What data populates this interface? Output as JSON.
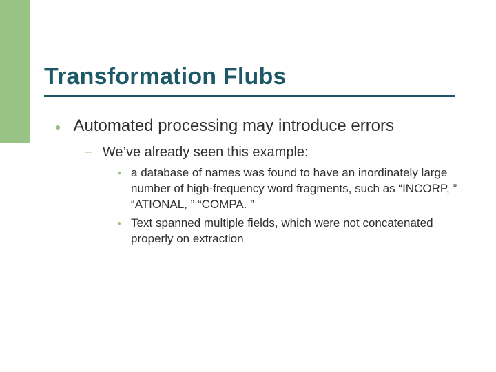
{
  "slide": {
    "title": "Transformation Flubs",
    "level1": {
      "text": "Automated processing may introduce errors"
    },
    "level2": {
      "text": "We’ve already seen this example:"
    },
    "level3": [
      {
        "text": "a database of names was found to have an inordinately large number of high-frequency word fragments, such as “INCORP, ” “ATIONAL, ” “COMPA. ”"
      },
      {
        "text": "Text spanned multiple fields, which were not concatenated properly on extraction"
      }
    ]
  },
  "colors": {
    "accent_green": "#99c285",
    "title_teal": "#1d5866"
  }
}
